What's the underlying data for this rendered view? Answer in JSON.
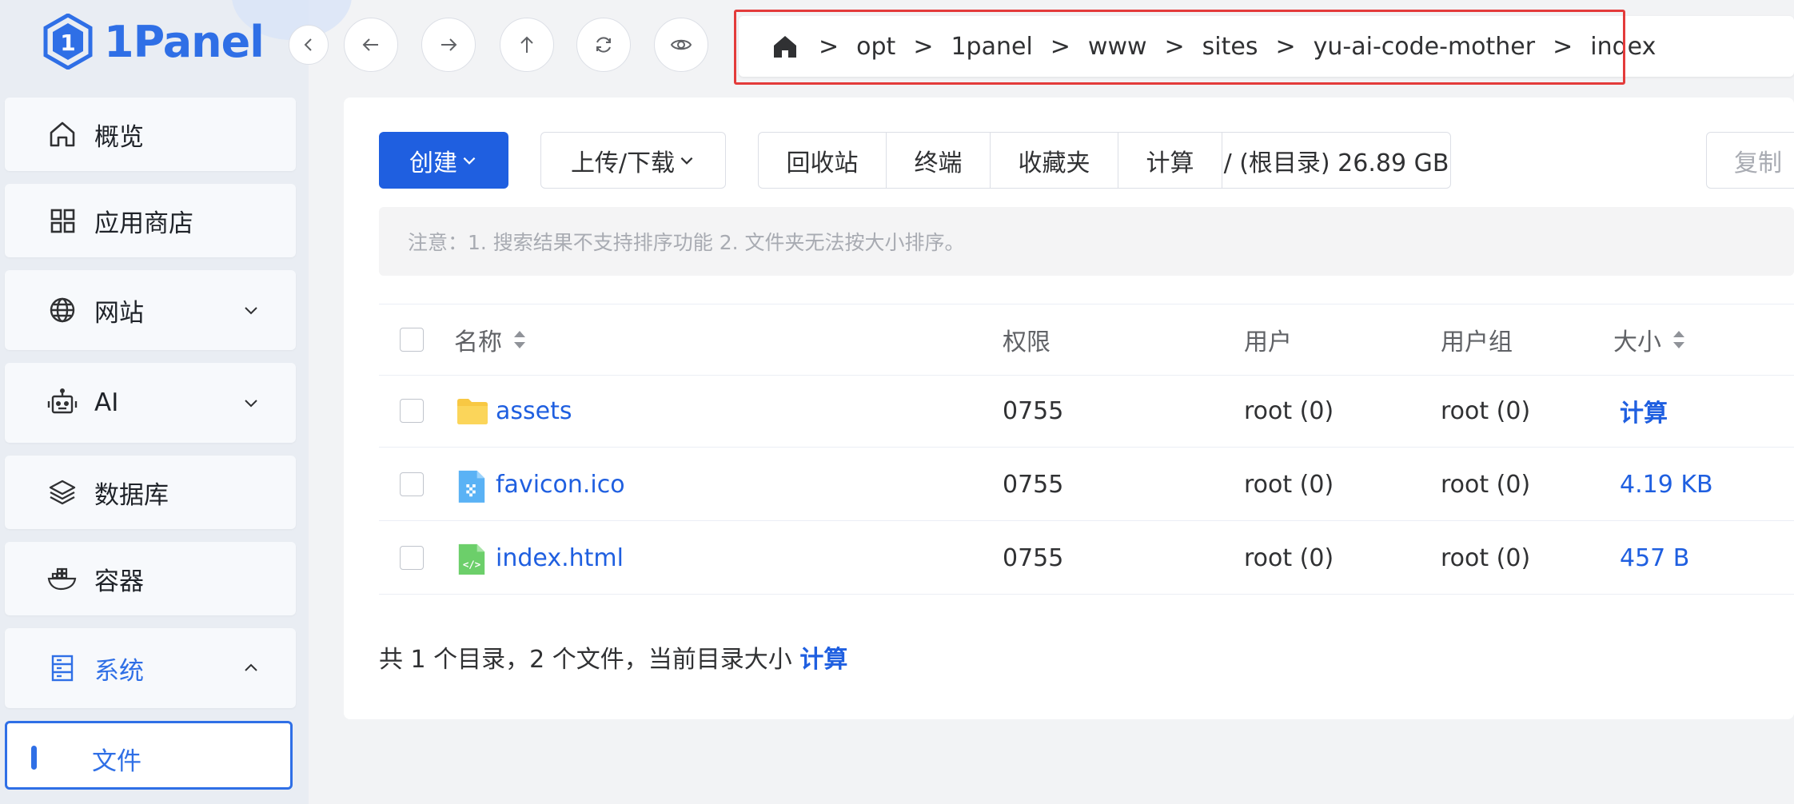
{
  "brand": {
    "name": "1Panel",
    "color": "#2f6fe6"
  },
  "sidebar": {
    "items": [
      {
        "label": "概览",
        "icon": "home-icon"
      },
      {
        "label": "应用商店",
        "icon": "grid-icon"
      },
      {
        "label": "网站",
        "icon": "globe-icon",
        "expandable": true
      },
      {
        "label": "AI",
        "icon": "robot-icon",
        "expandable": true
      },
      {
        "label": "数据库",
        "icon": "layers-icon"
      },
      {
        "label": "容器",
        "icon": "docker-icon"
      },
      {
        "label": "系统",
        "icon": "server-icon",
        "expanded": true
      }
    ],
    "active_sub": "文件"
  },
  "breadcrumb": {
    "home_icon": "home-icon",
    "parts": [
      "opt",
      "1panel",
      "www",
      "sites",
      "yu-ai-code-mother",
      "index"
    ],
    "separator": ">"
  },
  "toolbar": {
    "create": "创建",
    "upload_download": "上传/下载",
    "group": [
      "回收站",
      "终端",
      "收藏夹",
      "计算",
      "/ (根目录) 26.89 GB"
    ],
    "copy": "复制"
  },
  "notice": "注意：1. 搜索结果不支持排序功能 2. 文件夹无法按大小排序。",
  "table": {
    "headers": {
      "name": "名称",
      "perm": "权限",
      "user": "用户",
      "group": "用户组",
      "size": "大小"
    },
    "rows": [
      {
        "name": "assets",
        "type": "folder",
        "perm": "0755",
        "user": "root (0)",
        "group": "root (0)",
        "size": "计算"
      },
      {
        "name": "favicon.ico",
        "type": "image",
        "perm": "0755",
        "user": "root (0)",
        "group": "root (0)",
        "size": "4.19 KB"
      },
      {
        "name": "index.html",
        "type": "code",
        "perm": "0755",
        "user": "root (0)",
        "group": "root (0)",
        "size": "457 B"
      }
    ]
  },
  "summary": {
    "text": "共 1 个目录，2 个文件，当前目录大小",
    "link": "计算"
  },
  "colors": {
    "accent": "#1f5fe0",
    "highlight_border": "#e33b3b"
  }
}
